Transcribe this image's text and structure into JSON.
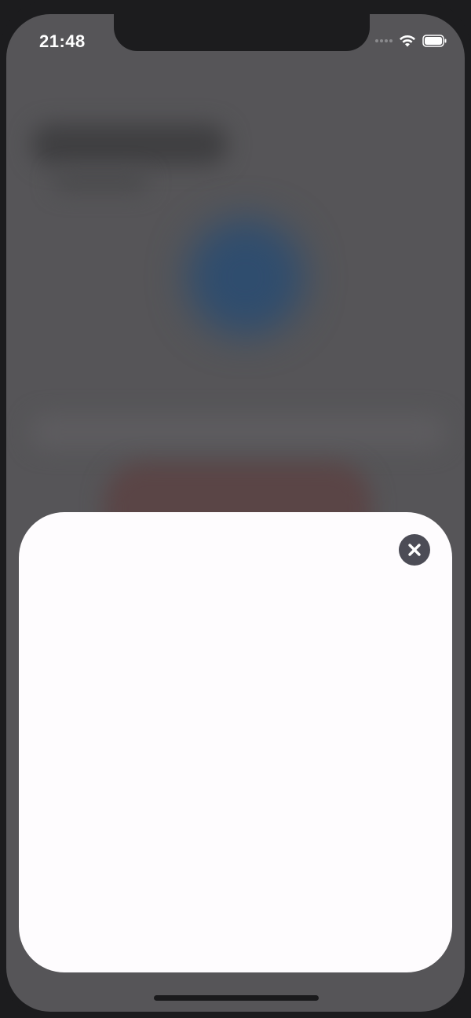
{
  "status_bar": {
    "time": "21:48",
    "wifi_icon": "wifi-icon",
    "battery_icon": "battery-icon",
    "signal_icon": "signal-dots-icon"
  },
  "sheet": {
    "close_icon": "close-icon"
  },
  "colors": {
    "dim_overlay": "#565558",
    "sheet_background": "#fefcfe",
    "close_button": "#4c4c56",
    "blurred_avatar": "#2f4d6e",
    "blurred_button": "#5a4546"
  }
}
